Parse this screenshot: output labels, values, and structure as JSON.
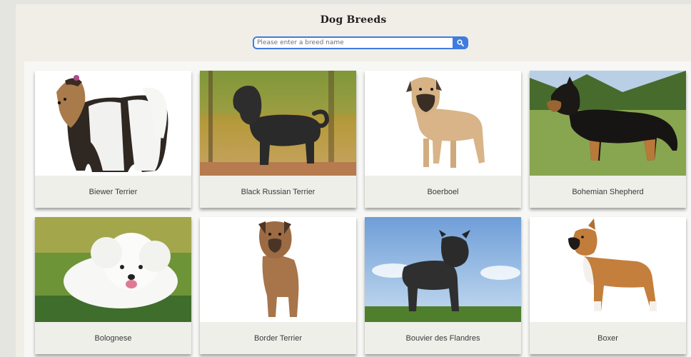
{
  "header": {
    "title": "Dog Breeds"
  },
  "search": {
    "placeholder": "Please enter a breed name",
    "value": "",
    "button_icon": "search-icon"
  },
  "colors": {
    "accent": "#3f7ce0",
    "page_bg": "#f1eee8",
    "caption_bg": "#efefea"
  },
  "breeds": [
    {
      "name": "Biewer Terrier"
    },
    {
      "name": "Black Russian Terrier"
    },
    {
      "name": "Boerboel"
    },
    {
      "name": "Bohemian Shepherd"
    },
    {
      "name": "Bolognese"
    },
    {
      "name": "Border Terrier"
    },
    {
      "name": "Bouvier des Flandres"
    },
    {
      "name": "Boxer"
    }
  ]
}
